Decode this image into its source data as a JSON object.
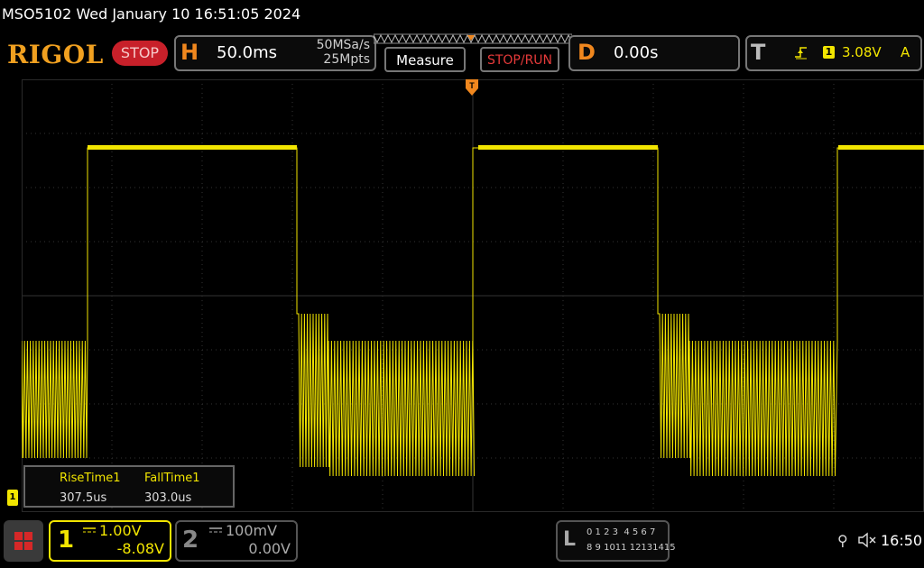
{
  "title_bar": {
    "text": "MSO5102  Wed January 10 16:51:05 2024"
  },
  "toolbar": {
    "logo": "RIGOL",
    "run_state": "STOP",
    "horizontal": {
      "letter": "H",
      "timebase": "50.0ms",
      "sample_rate": "50MSa/s",
      "memory_depth": "25Mpts"
    },
    "measure_label": "Measure",
    "stop_run_label": "STOP/RUN",
    "delay": {
      "letter": "D",
      "value": "0.00s"
    },
    "trigger": {
      "letter": "T",
      "source": "1",
      "level": "3.08V",
      "mode": "A",
      "edge_icon": "rising-edge-icon"
    }
  },
  "measurements": {
    "rise_label": "RiseTime1",
    "rise_value": "307.5us",
    "fall_label": "FallTime1",
    "fall_value": "303.0us"
  },
  "channel_markers": {
    "ch1_ground": "1"
  },
  "channels": [
    {
      "number": "1",
      "scale": "1.00V",
      "offset": "-8.08V",
      "color": "#f2e500",
      "active": true
    },
    {
      "number": "2",
      "scale": "100mV",
      "offset": "0.00V",
      "color": "#888888",
      "active": false
    }
  ],
  "logic_analyzer": {
    "letter": "L",
    "row1": "0 1 2 3  4 5 6 7",
    "row2": "8 9 1011 12131415"
  },
  "status": {
    "usb_icon": "usb-icon",
    "sound_icon": "speaker-muted-icon",
    "time": "16:50"
  },
  "colors": {
    "trace": "#f2e500",
    "accent": "#f0871e",
    "stop": "#c8202a",
    "grid": "#333333"
  }
}
